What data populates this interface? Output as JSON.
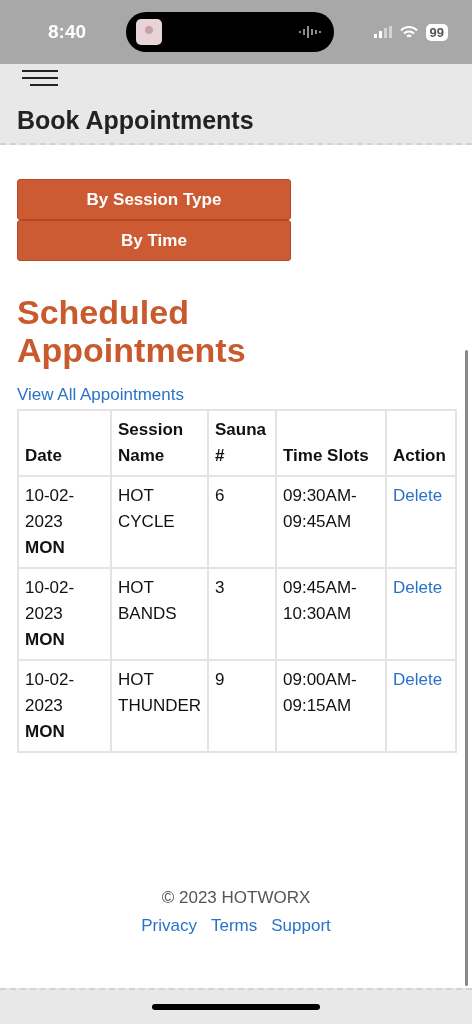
{
  "status_bar": {
    "time": "8:40",
    "battery": "99"
  },
  "header": {
    "title": "Book Appointments"
  },
  "buttons": [
    "By Session Type",
    "By Time"
  ],
  "section": {
    "title": "Scheduled Appointments",
    "link": "View All Appointments"
  },
  "table": {
    "columns": [
      "Date",
      "Session Name",
      "Sauna #",
      "Time Slots",
      "Action"
    ],
    "rows": [
      {
        "date": "10-02-2023",
        "day": "MON",
        "session": "HOT CYCLE",
        "sauna": "6",
        "time": "09:30AM-09:45AM",
        "action": "Delete"
      },
      {
        "date": "10-02-2023",
        "day": "MON",
        "session": "HOT BANDS",
        "sauna": "3",
        "time": "09:45AM-10:30AM",
        "action": "Delete"
      },
      {
        "date": "10-02-2023",
        "day": "MON",
        "session": "HOT THUNDER",
        "sauna": "9",
        "time": "09:00AM-09:15AM",
        "action": "Delete"
      }
    ]
  },
  "footer": {
    "copyright": "© 2023 HOTWORX",
    "links": [
      "Privacy",
      "Terms",
      "Support"
    ]
  }
}
